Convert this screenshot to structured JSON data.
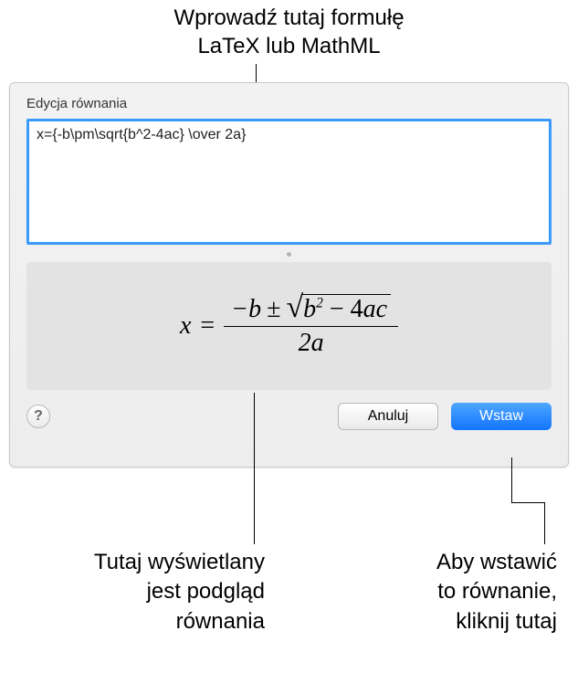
{
  "callouts": {
    "top_line1": "Wprowadź tutaj formułę",
    "top_line2": "LaTeX lub MathML",
    "bottom_left_line1": "Tutaj wyświetlany",
    "bottom_left_line2": "jest podgląd",
    "bottom_left_line3": "równania",
    "bottom_right_line1": "Aby wstawić",
    "bottom_right_line2": "to równanie,",
    "bottom_right_line3": "kliknij tutaj"
  },
  "dialog": {
    "title": "Edycja równania",
    "input_value": "x={-b\\pm\\sqrt{b^2-4ac} \\over 2a}",
    "cancel_label": "Anuluj",
    "insert_label": "Wstaw",
    "help_label": "?",
    "preview": {
      "lhs": "x",
      "eq": "=",
      "minus_b": "−b",
      "pm": "±",
      "b": "b",
      "exp": "2",
      "minus": "− 4",
      "ac": "ac",
      "denominator": "2a"
    }
  }
}
